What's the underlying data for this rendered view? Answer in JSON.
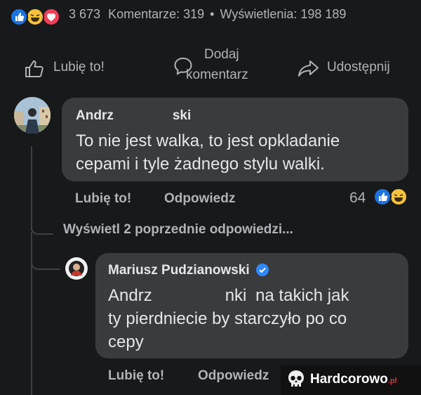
{
  "post_stats": {
    "reaction_icons": [
      "like-icon",
      "haha-icon",
      "love-icon"
    ],
    "reaction_count": "3 673",
    "comments_label": "Komentarze: 319",
    "separator": "•",
    "views_label": "Wyświetlenia: 198 189"
  },
  "actions": {
    "like_label": "Lubię to!",
    "comment_label_line1": "Dodaj",
    "comment_label_line2": "komentarz",
    "share_label": "Udostępnij"
  },
  "comment1": {
    "author_visible_start": "Andrz",
    "author_visible_end": "ski",
    "text_line1": "To nie jest walka, to jest opkladanie",
    "text_line2": "cepami i tyle żadnego stylu walki.",
    "like_link": "Lubię to!",
    "reply_link": "Odpowiedz",
    "reaction_count": "64",
    "reaction_icons": [
      "like-icon",
      "haha-icon"
    ]
  },
  "view_previous": "Wyświetl 2 poprzednie odpowiedzi...",
  "reply1": {
    "author": "Mariusz Pudzianowski",
    "verified": true,
    "mention_start": "Andrz",
    "mention_end": "nki",
    "text_line1_rest": "na takich jak",
    "text_line2": "ty pierdniecie by starczyło po co",
    "text_line3": "cepy",
    "like_link": "Lubię to!",
    "reply_link": "Odpowiedz"
  },
  "watermark": {
    "brand": "Hardcorowo",
    "suffix": ".pl"
  },
  "colors": {
    "background": "#18191a",
    "bubble": "#3a3b3c",
    "text": "#e4e6eb",
    "muted": "#b0b3b8",
    "like_blue": "#1b74e4",
    "haha_yellow": "#f7c33c",
    "love_red": "#f33e58"
  }
}
